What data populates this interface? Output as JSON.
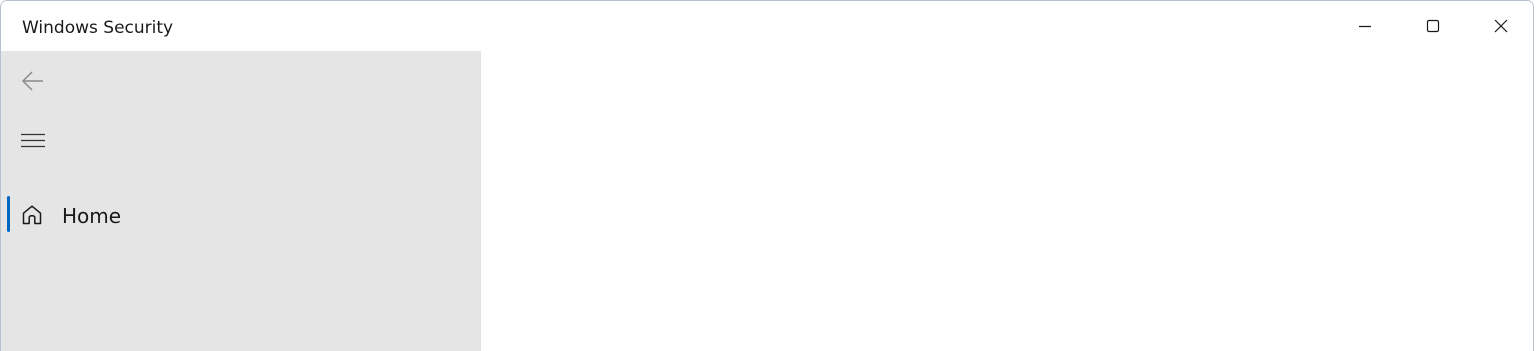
{
  "window": {
    "title": "Windows Security"
  },
  "caption_buttons": {
    "minimize_icon": "minimize-icon",
    "maximize_icon": "maximize-icon",
    "close_icon": "close-icon"
  },
  "sidebar": {
    "back_icon": "back-arrow-icon",
    "menu_icon": "hamburger-menu-icon",
    "items": [
      {
        "label": "Home",
        "icon": "home-icon",
        "selected": true
      }
    ]
  },
  "colors": {
    "accent": "#0067c0",
    "sidebar_bg": "#e5e5e5",
    "content_bg": "#ffffff"
  }
}
